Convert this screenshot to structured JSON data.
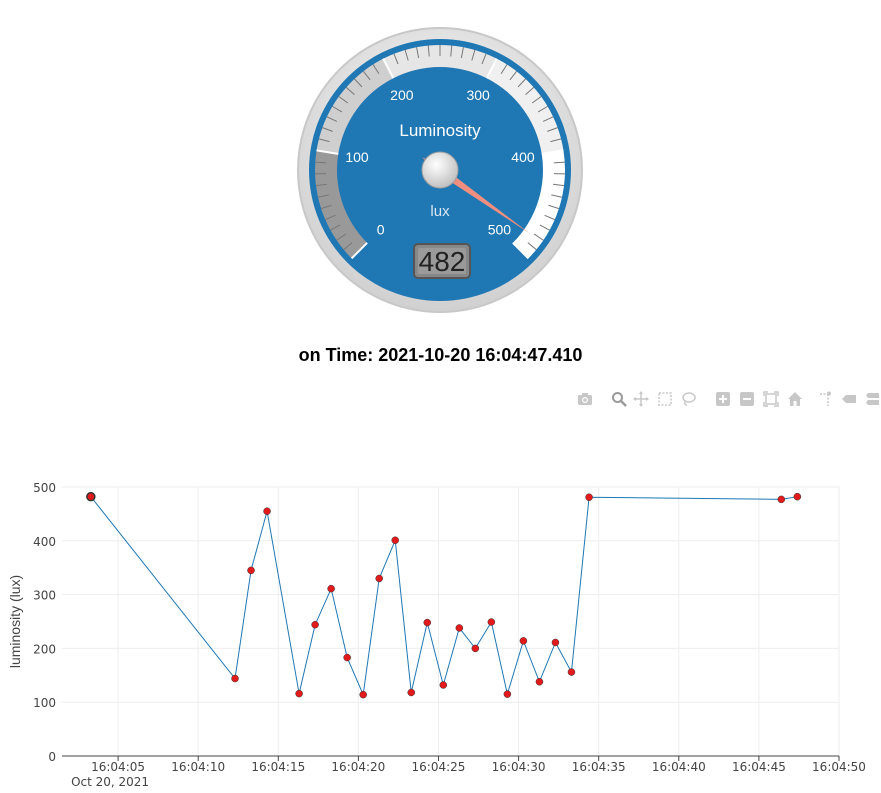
{
  "gauge": {
    "title": "Luminosity",
    "units": "lux",
    "value": 482,
    "value_display": "482",
    "min": 0,
    "max": 500,
    "major_ticks": [
      "0",
      "100",
      "200",
      "300",
      "400",
      "500"
    ],
    "colors": {
      "face": "#1f77b4",
      "needle": "#f08f7f",
      "plate": "#999999",
      "ring_light": "#e6e6e6",
      "ring_dark": "#aaaaaa"
    }
  },
  "time_label": "on Time: 2021-10-20 16:04:47.410",
  "toolbar": {
    "buttons": [
      "camera-icon",
      "zoom-icon",
      "pan-icon",
      "box-select-icon",
      "lasso-icon",
      "zoom-in-icon",
      "zoom-out-icon",
      "autoscale-icon",
      "reset-axes-icon",
      "spike-lines-icon",
      "hover-closest-icon",
      "hover-compare-icon"
    ]
  },
  "chart_data": {
    "type": "line",
    "xlabel": "",
    "ylabel": "luminosity (lux)",
    "date_label": "Oct 20, 2021",
    "ylim": [
      0,
      500
    ],
    "xlim": [
      "16:04:01.5",
      "16:04:50"
    ],
    "y_ticks": [
      "0",
      "100",
      "200",
      "300",
      "400",
      "500"
    ],
    "x_ticks": [
      "16:04:05",
      "16:04:10",
      "16:04:15",
      "16:04:20",
      "16:04:25",
      "16:04:30",
      "16:04:35",
      "16:04:40",
      "16:04:45",
      "16:04:50"
    ],
    "grid": true,
    "line_color": "#1f77b4",
    "marker_color": "#e31a1c",
    "x": [
      "16:04:03.3",
      "16:04:12.3",
      "16:04:13.3",
      "16:04:14.3",
      "16:04:16.3",
      "16:04:17.3",
      "16:04:18.3",
      "16:04:19.3",
      "16:04:20.3",
      "16:04:21.3",
      "16:04:22.3",
      "16:04:23.3",
      "16:04:24.3",
      "16:04:25.3",
      "16:04:26.3",
      "16:04:27.3",
      "16:04:28.3",
      "16:04:29.3",
      "16:04:30.3",
      "16:04:31.3",
      "16:04:32.3",
      "16:04:33.3",
      "16:04:34.4",
      "16:04:46.4",
      "16:04:47.4"
    ],
    "y": [
      482,
      144,
      345,
      455,
      116,
      244,
      311,
      183,
      114,
      330,
      401,
      118,
      248,
      132,
      238,
      200,
      249,
      115,
      214,
      138,
      211,
      156,
      481,
      477,
      482
    ]
  }
}
